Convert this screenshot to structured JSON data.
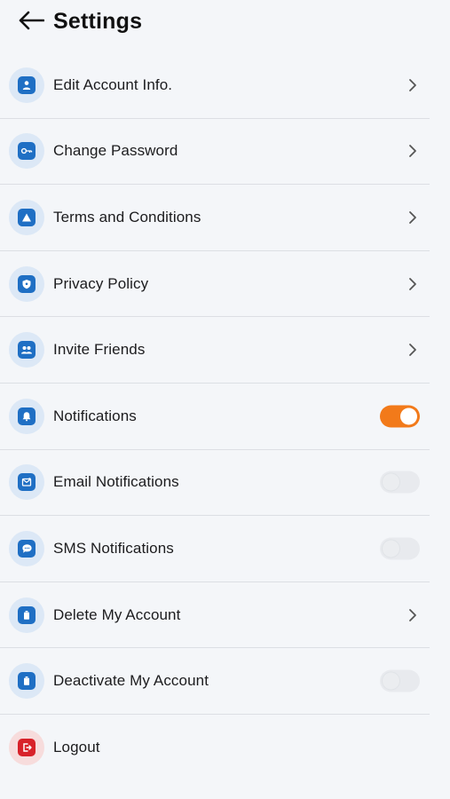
{
  "header": {
    "title": "Settings",
    "back_icon": "arrow-left-icon"
  },
  "colors": {
    "background": "#f4f6f9",
    "accent_blue": "#1f6fc4",
    "icon_circle": "#dce8f6",
    "toggle_on": "#f27a1a",
    "toggle_off": "#e8eaee",
    "logout_red": "#d8222a"
  },
  "settings": {
    "items": [
      {
        "label": "Edit Account Info.",
        "icon": "user-icon",
        "control": "chevron"
      },
      {
        "label": "Change Password",
        "icon": "key-icon",
        "control": "chevron"
      },
      {
        "label": "Terms and Conditions",
        "icon": "warning-icon",
        "control": "chevron"
      },
      {
        "label": "Privacy Policy",
        "icon": "shield-icon",
        "control": "chevron"
      },
      {
        "label": "Invite Friends",
        "icon": "users-icon",
        "control": "chevron"
      },
      {
        "label": "Notifications",
        "icon": "bell-icon",
        "control": "toggle",
        "enabled": true
      },
      {
        "label": "Email Notifications",
        "icon": "mail-icon",
        "control": "toggle",
        "enabled": false
      },
      {
        "label": "SMS Notifications",
        "icon": "chat-icon",
        "control": "toggle",
        "enabled": false
      },
      {
        "label": "Delete My Account",
        "icon": "trash-icon",
        "control": "chevron"
      },
      {
        "label": "Deactivate My Account",
        "icon": "trash-icon",
        "control": "toggle",
        "enabled": false
      },
      {
        "label": "Logout",
        "icon": "logout-icon",
        "control": "none"
      }
    ]
  }
}
